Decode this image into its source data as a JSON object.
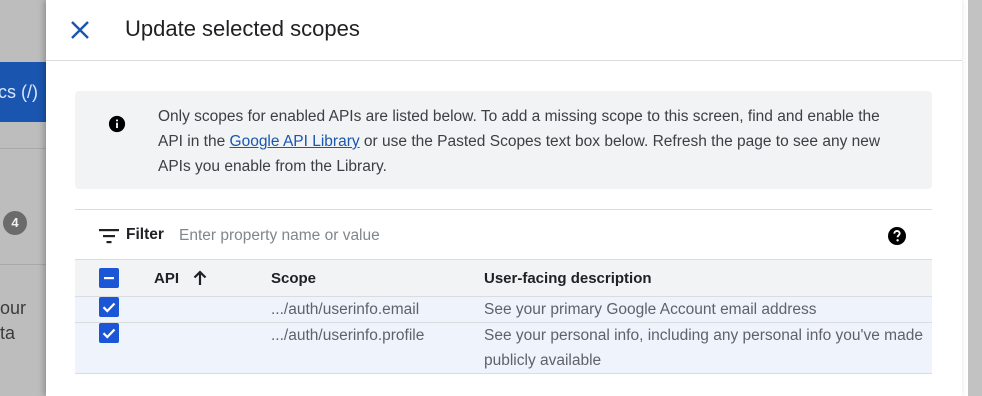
{
  "background": {
    "tab_label": "cs (/)",
    "badge_count": "4",
    "text_line_1": "our",
    "text_line_2": "ta"
  },
  "panel": {
    "title": "Update selected scopes",
    "close_icon": "close-icon"
  },
  "info": {
    "icon": "info-icon",
    "text_before_link": "Only scopes for enabled APIs are listed below. To add a missing scope to this screen, find and enable the API in the ",
    "link_text": "Google API Library",
    "text_after_link": " or use the Pasted Scopes text box below. Refresh the page to see any new APIs you enable from the Library."
  },
  "filter": {
    "label": "Filter",
    "placeholder": "Enter property name or value",
    "value": ""
  },
  "table": {
    "headers": {
      "api": "API",
      "scope": "Scope",
      "description": "User-facing description"
    },
    "rows": [
      {
        "checked": true,
        "api": "",
        "scope": ".../auth/userinfo.email",
        "description": "See your primary Google Account email address"
      },
      {
        "checked": true,
        "api": "",
        "scope": ".../auth/userinfo.profile",
        "description": "See your personal info, including any personal info you've made publicly available"
      }
    ]
  },
  "colors": {
    "accent": "#1a56d6",
    "link": "#1a56b0",
    "info_bg": "#f1f3f4",
    "selected_row_bg": "#eef3fc"
  }
}
